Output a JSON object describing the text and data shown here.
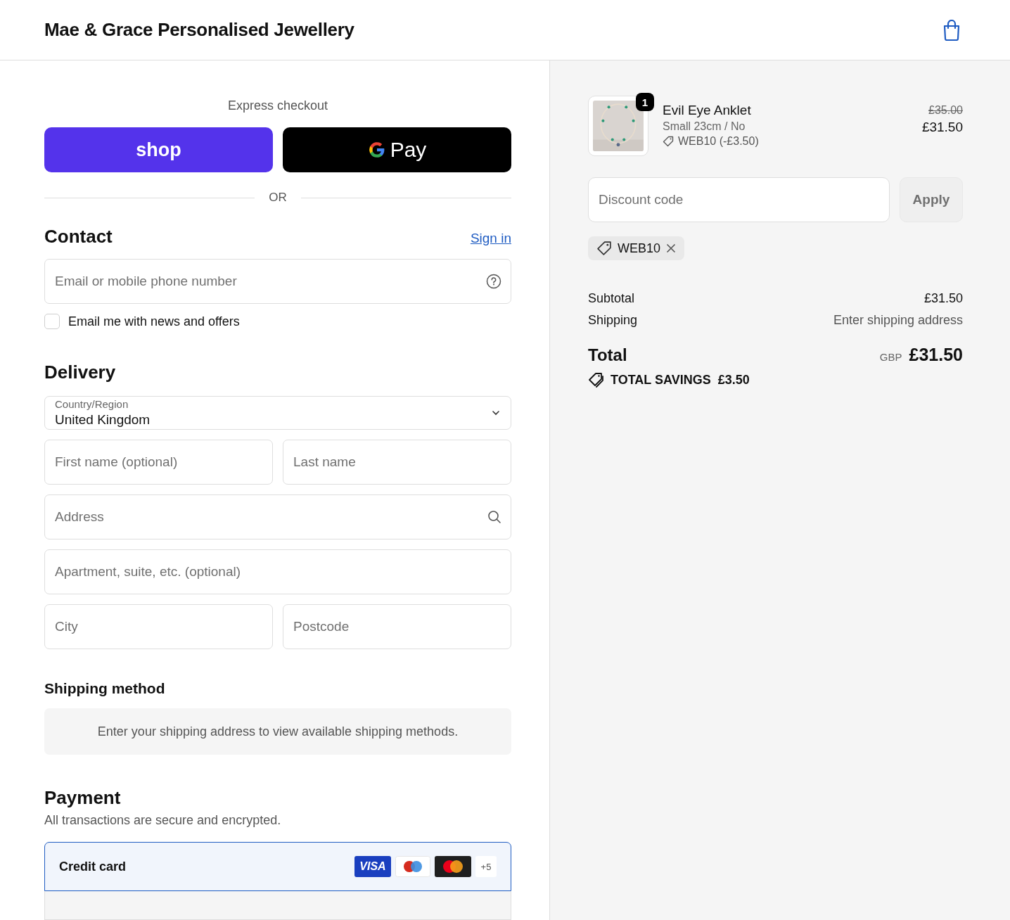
{
  "header": {
    "store_name": "Mae & Grace Personalised Jewellery"
  },
  "express": {
    "title": "Express checkout",
    "shop_label": "shop",
    "gpay_label": "Pay",
    "or_label": "OR"
  },
  "contact": {
    "title": "Contact",
    "sign_in": "Sign in",
    "email_placeholder": "Email or mobile phone number",
    "news_label": "Email me with news and offers",
    "news_checked": false
  },
  "delivery": {
    "title": "Delivery",
    "country_label": "Country/Region",
    "country_value": "United Kingdom",
    "rows": [
      [
        {
          "placeholder": "First name (optional)"
        },
        {
          "placeholder": "Last name"
        }
      ],
      [
        {
          "placeholder": "Address",
          "kind": "search"
        }
      ],
      [
        {
          "placeholder": "Apartment, suite, etc. (optional)"
        }
      ],
      [
        {
          "placeholder": "City"
        },
        {
          "placeholder": "Postcode"
        }
      ]
    ]
  },
  "shipping_method": {
    "title": "Shipping method",
    "message": "Enter your shipping address to view available shipping methods."
  },
  "payment": {
    "title": "Payment",
    "subtitle": "All transactions are secure and encrypted.",
    "methods": [
      {
        "label": "Credit card",
        "selected": true,
        "cards": [
          {
            "kind": "visa",
            "label": "VISA"
          },
          {
            "kind": "maestro"
          },
          {
            "kind": "mastercard"
          },
          {
            "kind": "more",
            "label": "+5"
          }
        ]
      }
    ]
  },
  "summary": {
    "items": [
      {
        "name": "Evil Eye Anklet",
        "variant": "Small 23cm / No",
        "discount": "WEB10 (-£3.50)",
        "quantity": "1",
        "original_price": "£35.00",
        "price": "£31.50"
      }
    ],
    "discount_placeholder": "Discount code",
    "apply_label": "Apply",
    "apply_disabled": true,
    "applied_codes": [
      "WEB10"
    ],
    "rows": [
      {
        "label": "Subtotal",
        "value": "£31.50",
        "kind": "amount"
      },
      {
        "label": "Shipping",
        "value": "Enter shipping address",
        "kind": "note"
      }
    ],
    "total": {
      "label": "Total",
      "currency": "GBP",
      "amount": "£31.50"
    },
    "savings": {
      "label": "TOTAL SAVINGS",
      "amount": "£3.50"
    }
  }
}
